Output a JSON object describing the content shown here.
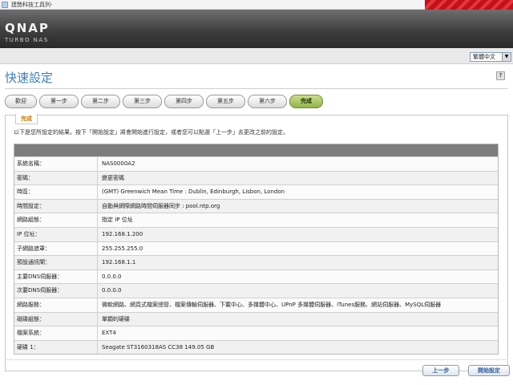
{
  "browser": {
    "title": "建勢科技工具列-"
  },
  "header": {
    "logo": "QNAP",
    "sublogo": "TURBO NAS"
  },
  "language": {
    "selected": "繁體中文",
    "dropdown_glyph": "▼"
  },
  "page": {
    "title": "快速設定",
    "help_glyph": "?"
  },
  "steps": [
    {
      "label": "歡迎",
      "active": false
    },
    {
      "label": "第一步",
      "active": false
    },
    {
      "label": "第二步",
      "active": false
    },
    {
      "label": "第三步",
      "active": false
    },
    {
      "label": "第四步",
      "active": false
    },
    {
      "label": "第五步",
      "active": false
    },
    {
      "label": "第六步",
      "active": false
    },
    {
      "label": "完成",
      "active": true
    }
  ],
  "panel": {
    "tab_label": "完成",
    "intro": "以下是您所設定的結果。按下「開始設定」將會開始進行設定，或者您可以點選「上一步」去更改之前的設定。"
  },
  "summary": [
    {
      "label": "系統名稱：",
      "value": "NAS0000A2"
    },
    {
      "label": "密碼：",
      "value": "變更密碼"
    },
    {
      "label": "時區：",
      "value": "(GMT) Greenwich Mean Time : Dublin, Edinburgh, Lisbon, London"
    },
    {
      "label": "時間設定：",
      "value": "自動與網際網路時間伺服器同步 : pool.ntp.org"
    },
    {
      "label": "網路組態：",
      "value": "指定 IP 位址"
    },
    {
      "label": "IP 位址：",
      "value": "192.168.1.200"
    },
    {
      "label": "子網路遮罩：",
      "value": "255.255.255.0"
    },
    {
      "label": "預設通訊閘：",
      "value": "192.168.1.1"
    },
    {
      "label": "主要DNS伺服器：",
      "value": "0.0.0.0"
    },
    {
      "label": "次要DNS伺服器：",
      "value": "0.0.0.0"
    },
    {
      "label": "網路服務：",
      "value": "微軟網路、網頁式檔案總管、檔案傳輸伺服器、下載中心、多媒體中心、UPnP 多媒體伺服器、iTunes服務、網站伺服器、MySQL伺服器"
    },
    {
      "label": "磁碟組態：",
      "value": "單顆的硬碟"
    },
    {
      "label": "檔案系統：",
      "value": "EXT4"
    },
    {
      "label": "硬碟 1：",
      "value": "Seagate ST3160318AS CC38 149.05 GB"
    }
  ],
  "buttons": {
    "back": "上一步",
    "start": "開始設定"
  }
}
